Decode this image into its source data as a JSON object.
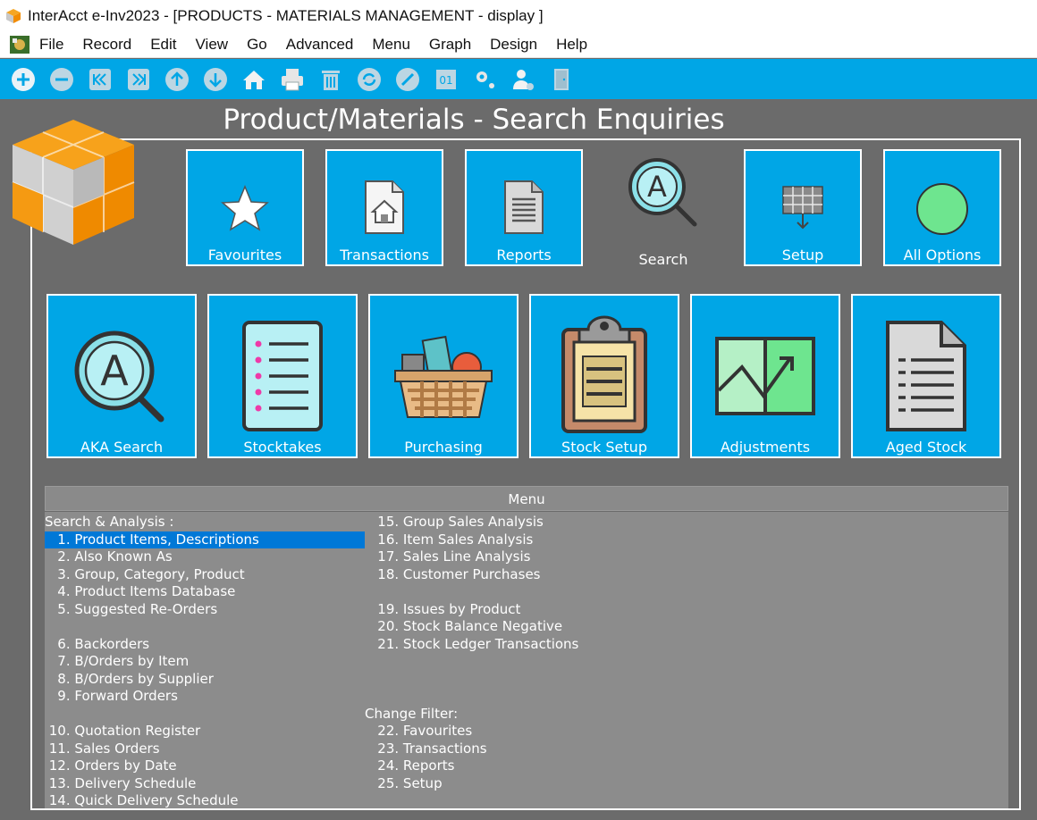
{
  "window": {
    "title": "InterAcct e-Inv2023 - [PRODUCTS - MATERIALS MANAGEMENT - display ]"
  },
  "menubar": [
    "File",
    "Record",
    "Edit",
    "View",
    "Go",
    "Advanced",
    "Menu",
    "Graph",
    "Design",
    "Help"
  ],
  "toolbar": [
    "add-icon",
    "remove-icon",
    "first-record-icon",
    "last-record-icon",
    "previous-icon",
    "next-icon",
    "home-icon",
    "print-icon",
    "delete-icon",
    "refresh-icon",
    "cancel-icon",
    "counter-icon",
    "settings-icon",
    "user-settings-icon",
    "exit-door-icon"
  ],
  "page": {
    "title": "Product/Materials - Search Enquiries"
  },
  "top_tiles": [
    {
      "label": "Favourites",
      "icon": "star-icon"
    },
    {
      "label": "Transactions",
      "icon": "house-document-icon"
    },
    {
      "label": "Reports",
      "icon": "report-document-icon"
    },
    {
      "label": "Search",
      "icon": "search-a-icon"
    },
    {
      "label": "Setup",
      "icon": "grid-setup-icon"
    },
    {
      "label": "All Options",
      "icon": "green-circle-icon"
    }
  ],
  "big_tiles": [
    {
      "label": "AKA Search",
      "icon": "search-a-icon"
    },
    {
      "label": "Stocktakes",
      "icon": "checklist-icon"
    },
    {
      "label": "Purchasing",
      "icon": "basket-icon"
    },
    {
      "label": "Stock Setup",
      "icon": "clipboard-icon"
    },
    {
      "label": "Adjustments",
      "icon": "chart-board-icon"
    },
    {
      "label": "Aged Stock",
      "icon": "document-icon"
    }
  ],
  "menu": {
    "header": "Menu",
    "col1": [
      "Search & Analysis :",
      "   1. Product Items, Descriptions",
      "   2. Also Known As",
      "   3. Group, Category, Product",
      "   4. Product Items Database",
      "   5. Suggested Re-Orders",
      "",
      "   6. Backorders",
      "   7. B/Orders by Item",
      "   8. B/Orders by Supplier",
      "   9. Forward Orders",
      "",
      " 10. Quotation Register",
      " 11. Sales Orders",
      " 12. Orders by Date",
      " 13. Delivery Schedule",
      " 14. Quick Delivery Schedule"
    ],
    "col2": [
      "   15. Group Sales Analysis",
      "   16. Item Sales Analysis",
      "   17. Sales Line Analysis",
      "   18. Customer Purchases",
      "",
      "   19. Issues by Product",
      "   20. Stock Balance Negative",
      "   21. Stock Ledger Transactions",
      "",
      "",
      "",
      "Change Filter:",
      "   22. Favourites",
      "   23. Transactions",
      "   24. Reports",
      "   25. Setup"
    ],
    "selected": "   1. Product Items, Descriptions"
  }
}
